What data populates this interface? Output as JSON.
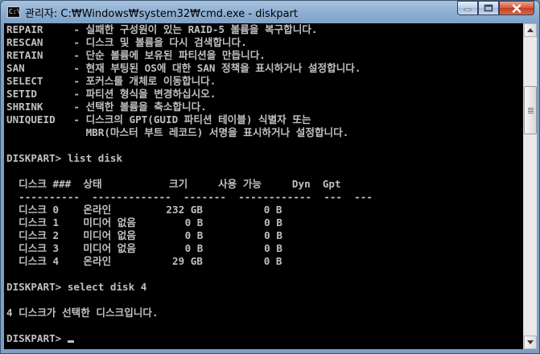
{
  "window": {
    "title": "관리자: C:₩Windows₩system32₩cmd.exe - diskpart",
    "icon_text": "C:\\",
    "icons": {
      "app": "cmd-icon",
      "minimize": "minimize-icon",
      "maximize": "maximize-icon",
      "close": "close-icon"
    }
  },
  "console": {
    "lines": [
      "REPAIR     - 실패한 구성원이 있는 RAID-5 볼륨을 복구합니다.",
      "RESCAN     - 디스크 및 볼륨을 다시 검색합니다.",
      "RETAIN     - 단순 볼륨에 보유된 파티션을 만듭니다.",
      "SAN        - 현재 부팅된 OS에 대한 SAN 정책을 표시하거나 설정합니다.",
      "SELECT     - 포커스를 개체로 이동합니다.",
      "SETID      - 파티션 형식을 변경하십시오.",
      "SHRINK     - 선택한 볼륨을 축소합니다.",
      "UNIQUEID   - 디스크의 GPT(GUID 파티션 테이블) 식별자 또는",
      "             MBR(마스터 부트 레코드) 서명을 표시하거나 설정합니다.",
      "",
      "DISKPART> list disk",
      "",
      "  디스크 ###  상태           크기     사용 가능     Dyn  Gpt",
      "  ----------  -------------  -------  ------------  ---  ---",
      "  디스크 0    온라인         232 GB          0 B",
      "  디스크 1    미디어 없음        0 B          0 B",
      "  디스크 2    미디어 없음        0 B          0 B",
      "  디스크 3    미디어 없음        0 B          0 B",
      "  디스크 4    온라인          29 GB          0 B",
      "",
      "DISKPART> select disk 4",
      "",
      "4 디스크가 선택한 디스크입니다.",
      "",
      "DISKPART> "
    ]
  },
  "colors": {
    "console_bg": "#000000",
    "console_fg": "#c0c0c0"
  }
}
